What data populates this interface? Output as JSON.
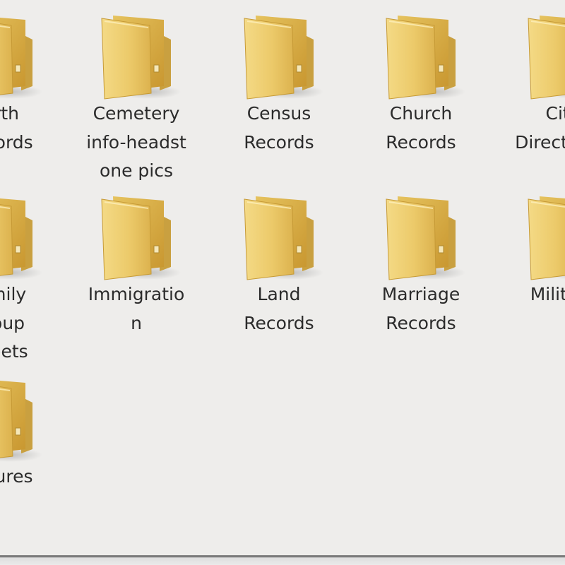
{
  "folders": [
    {
      "label": "Birth\nRecords",
      "icon": "folder-icon"
    },
    {
      "label": "Cemetery\ninfo-headst\none pics",
      "icon": "folder-icon"
    },
    {
      "label": "Census\nRecords",
      "icon": "folder-icon"
    },
    {
      "label": "Church\nRecords",
      "icon": "folder-icon"
    },
    {
      "label": "City\nDirectories",
      "icon": "folder-icon"
    },
    {
      "label": "Family\nGroup\nSheets",
      "icon": "folder-icon"
    },
    {
      "label": "Immigratio\nn",
      "icon": "folder-icon"
    },
    {
      "label": "Land\nRecords",
      "icon": "folder-icon"
    },
    {
      "label": "Marriage\nRecords",
      "icon": "folder-icon"
    },
    {
      "label": "Military",
      "icon": "folder-icon"
    },
    {
      "label": "Pictures",
      "icon": "folder-icon"
    }
  ],
  "colors": {
    "background": "#eeedeb",
    "folder_front": "#e9c765",
    "folder_back": "#d8ad48",
    "label_text": "#2b2b2b"
  }
}
